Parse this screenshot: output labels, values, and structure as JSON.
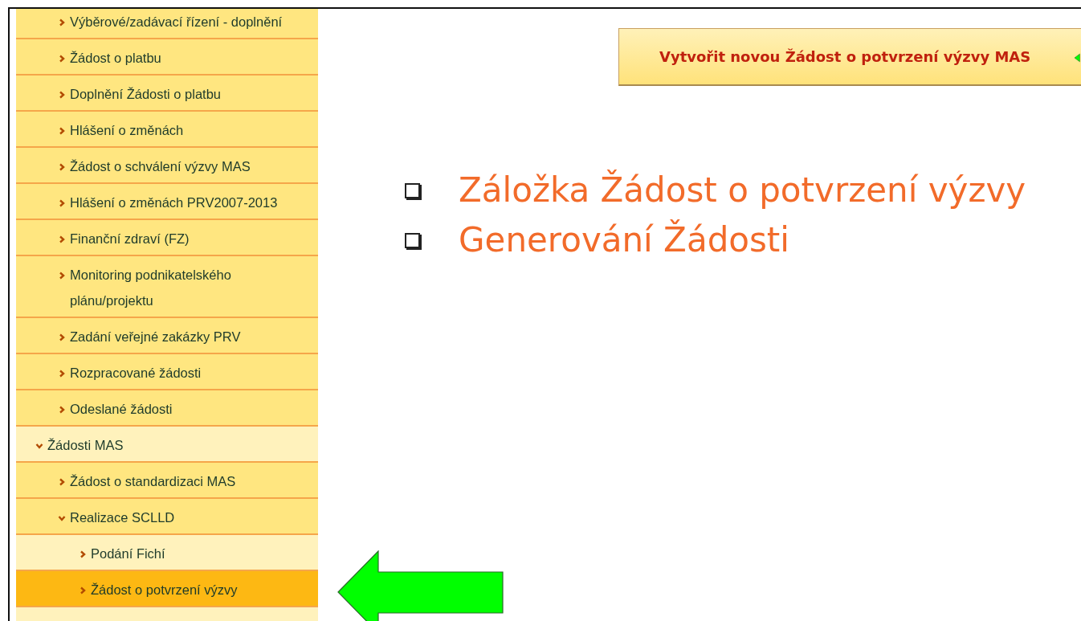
{
  "menu": {
    "items": [
      {
        "label": "Výběrové/zadávací řízení - doplnění",
        "expanded": false,
        "selected": false
      },
      {
        "label": "Žádost o platbu",
        "expanded": false,
        "selected": false
      },
      {
        "label": "Doplnění Žádosti o platbu",
        "expanded": false,
        "selected": false
      },
      {
        "label": "Hlášení o změnách",
        "expanded": false,
        "selected": false
      },
      {
        "label": "Žádost o schválení výzvy MAS",
        "expanded": false,
        "selected": false
      },
      {
        "label": "Hlášení o změnách PRV2007-2013",
        "expanded": false,
        "selected": false
      },
      {
        "label": "Finanční zdraví (FZ)",
        "expanded": false,
        "selected": false
      },
      {
        "label": "Monitoring podnikatelského plánu/projektu",
        "expanded": false,
        "selected": false
      },
      {
        "label": "Zadání veřejné zakázky PRV",
        "expanded": false,
        "selected": false
      },
      {
        "label": "Rozpracované žádosti",
        "expanded": false,
        "selected": false
      },
      {
        "label": "Odeslané žádosti",
        "expanded": false,
        "selected": false
      }
    ],
    "groups": [
      {
        "label": "Žádosti MAS",
        "expanded": true,
        "selected": false,
        "children": [
          {
            "label": "Žádost o standardizaci MAS",
            "expanded": false,
            "selected": false
          },
          {
            "label": "Realizace SCLLD",
            "expanded": true,
            "selected": false,
            "children": [
              {
                "label": "Podání Fichí",
                "expanded": false,
                "selected": false
              },
              {
                "label": "Žádost o potvrzení výzvy",
                "expanded": false,
                "selected": true
              }
            ]
          }
        ]
      }
    ]
  },
  "create_button": {
    "label": "Vytvořit novou Žádost o potvrzení výzvy MAS"
  },
  "bullets": [
    "Záložka Žádost o potvrzení výzvy",
    "Generování Žádosti"
  ]
}
